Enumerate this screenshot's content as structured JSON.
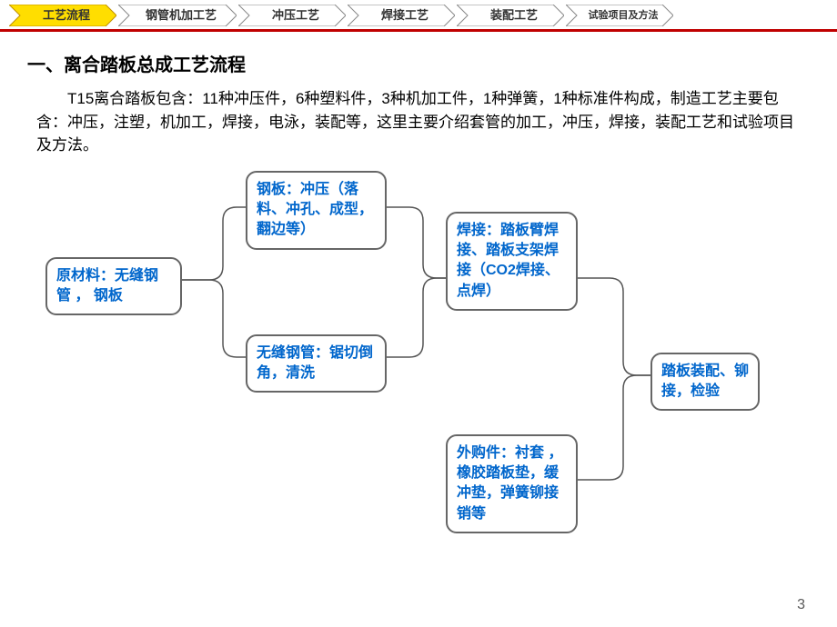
{
  "nav": {
    "items": [
      {
        "label": "工艺流程",
        "active": true
      },
      {
        "label": "钢管机加工艺",
        "active": false
      },
      {
        "label": "冲压工艺",
        "active": false
      },
      {
        "label": "焊接工艺",
        "active": false
      },
      {
        "label": "装配工艺",
        "active": false
      },
      {
        "label": "试验项目及方法",
        "active": false,
        "twoLine": true
      }
    ]
  },
  "heading": "一、离合踏板总成工艺流程",
  "paragraph": "T15离合踏板包含：11种冲压件，6种塑料件，3种机加工件，1种弹簧，1种标准件构成，制造工艺主要包含：冲压，注塑，机加工，焊接，电泳，装配等，这里主要介绍套管的加工，冲压，焊接，装配工艺和试验项目及方法。",
  "diagram": {
    "box1": "原材料：无缝钢管 ， 钢板",
    "box2": "钢板：冲压（落料、冲孔、成型，翻边等）",
    "box3": "无缝钢管：锯切倒角，清洗",
    "box4": "焊接：踏板臂焊接、踏板支架焊接（CO2焊接、点焊）",
    "box5": "外购件：衬套 ，橡胶踏板垫，缓冲垫，弹簧铆接销等",
    "box6": "踏板装配、铆接，检验"
  },
  "pageNumber": "3"
}
